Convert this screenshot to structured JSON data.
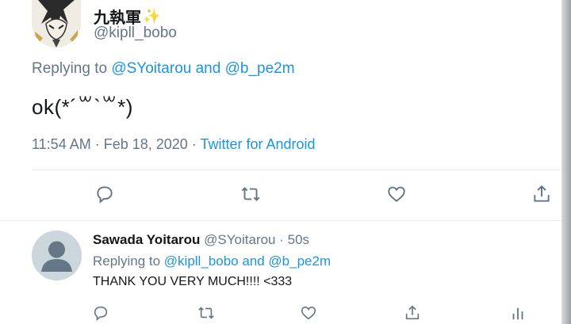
{
  "colors": {
    "accent": "#1b95e0",
    "muted": "#657786",
    "text": "#14171a",
    "divider": "#e6ecf0"
  },
  "main_tweet": {
    "display_name": "九執軍",
    "handle": "@kipll_bobo",
    "replying_prefix": "Replying to ",
    "mention_1": "@SYoitarou",
    "and": " and ",
    "mention_2": "@b_pe2m",
    "text": "ok(*´꒳`꒳*)",
    "timestamp": "11:54 AM · Feb 18, 2020 · ",
    "source": "Twitter for Android",
    "actions": [
      "reply-icon",
      "retweet-icon",
      "like-icon",
      "share-icon"
    ]
  },
  "reply_tweet": {
    "display_name": "Sawada Yoitarou",
    "handle": "@SYoitarou",
    "time": " · 50s",
    "replying_prefix": "Replying to ",
    "mention_1": "@kipll_bobo",
    "and": " and ",
    "mention_2": "@b_pe2m",
    "text": "THANK YOU VERY MUCH!!!! <333",
    "actions": [
      "reply-icon",
      "retweet-icon",
      "like-icon",
      "share-icon",
      "analytics-icon"
    ]
  }
}
